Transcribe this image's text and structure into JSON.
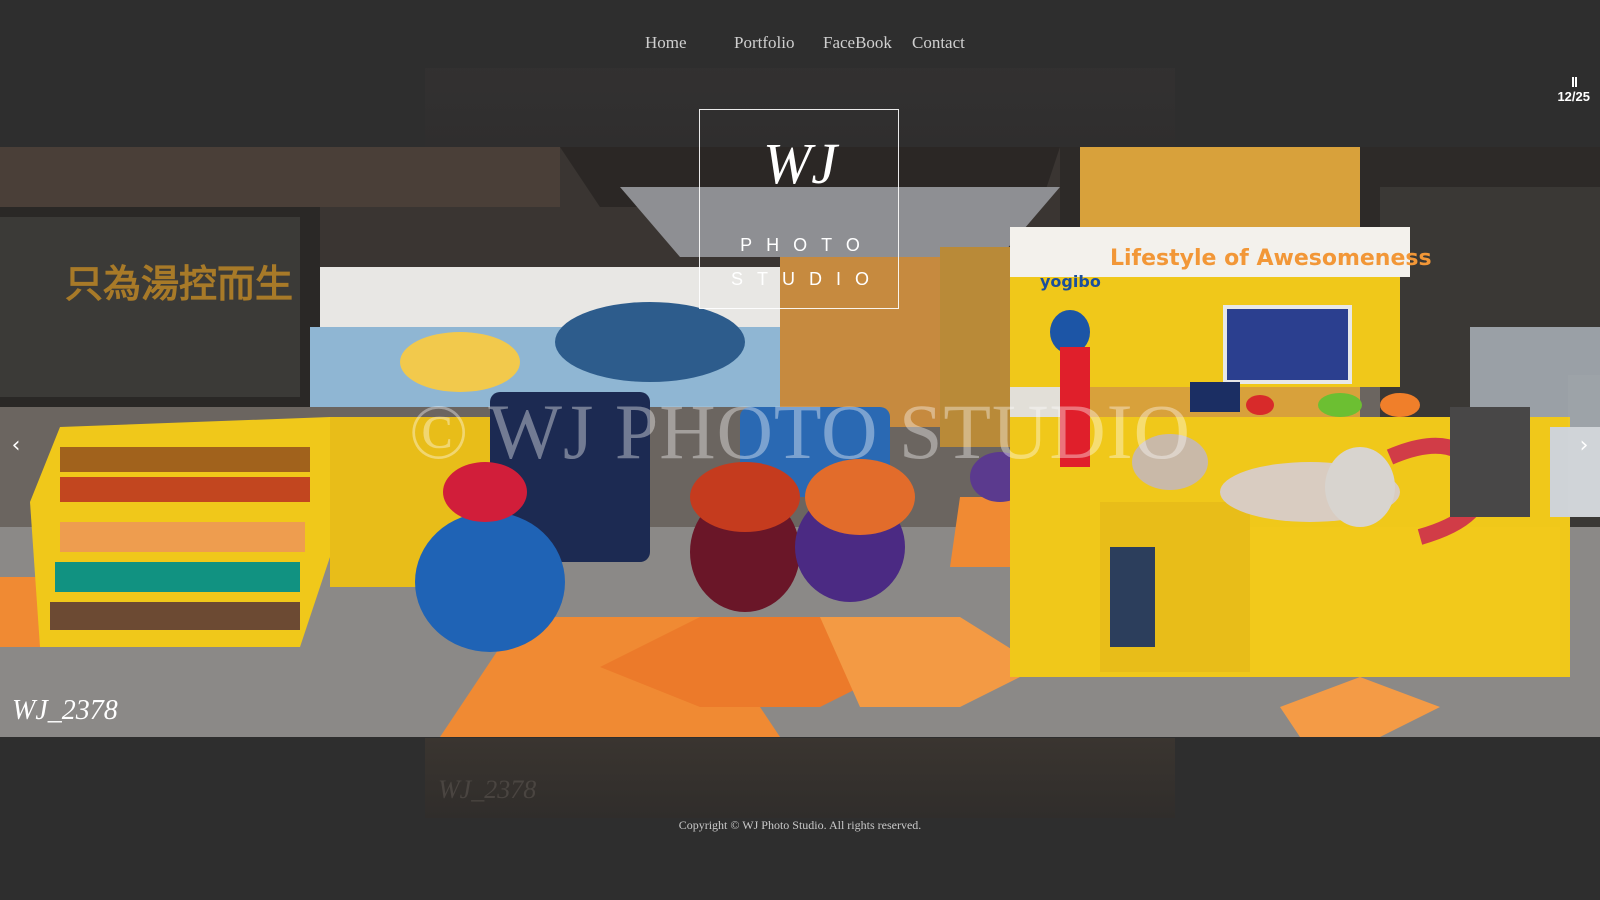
{
  "nav": {
    "items": [
      {
        "label": "Home"
      },
      {
        "label": "Portfolio"
      },
      {
        "label": "FaceBook"
      },
      {
        "label": "Contact"
      }
    ]
  },
  "slideshow": {
    "counter": "12/25",
    "pause_icon": "pause-icon",
    "prev_icon": "chevron-left-icon",
    "next_icon": "chevron-right-icon"
  },
  "logo": {
    "mark": "WJ",
    "line1": "PHOTO",
    "line2": "STUDIO"
  },
  "photo": {
    "watermark": "© WJ PHOTO STUDIO",
    "caption": "WJ_2378",
    "sign_text": "Lifestyle of Awesomeness",
    "brand_text": "yogibo",
    "store_text": "只為湯控而生"
  },
  "reflection": {
    "caption": "WJ_2378"
  },
  "footer": {
    "copyright": "Copyright © WJ Photo Studio. All rights reserved."
  }
}
